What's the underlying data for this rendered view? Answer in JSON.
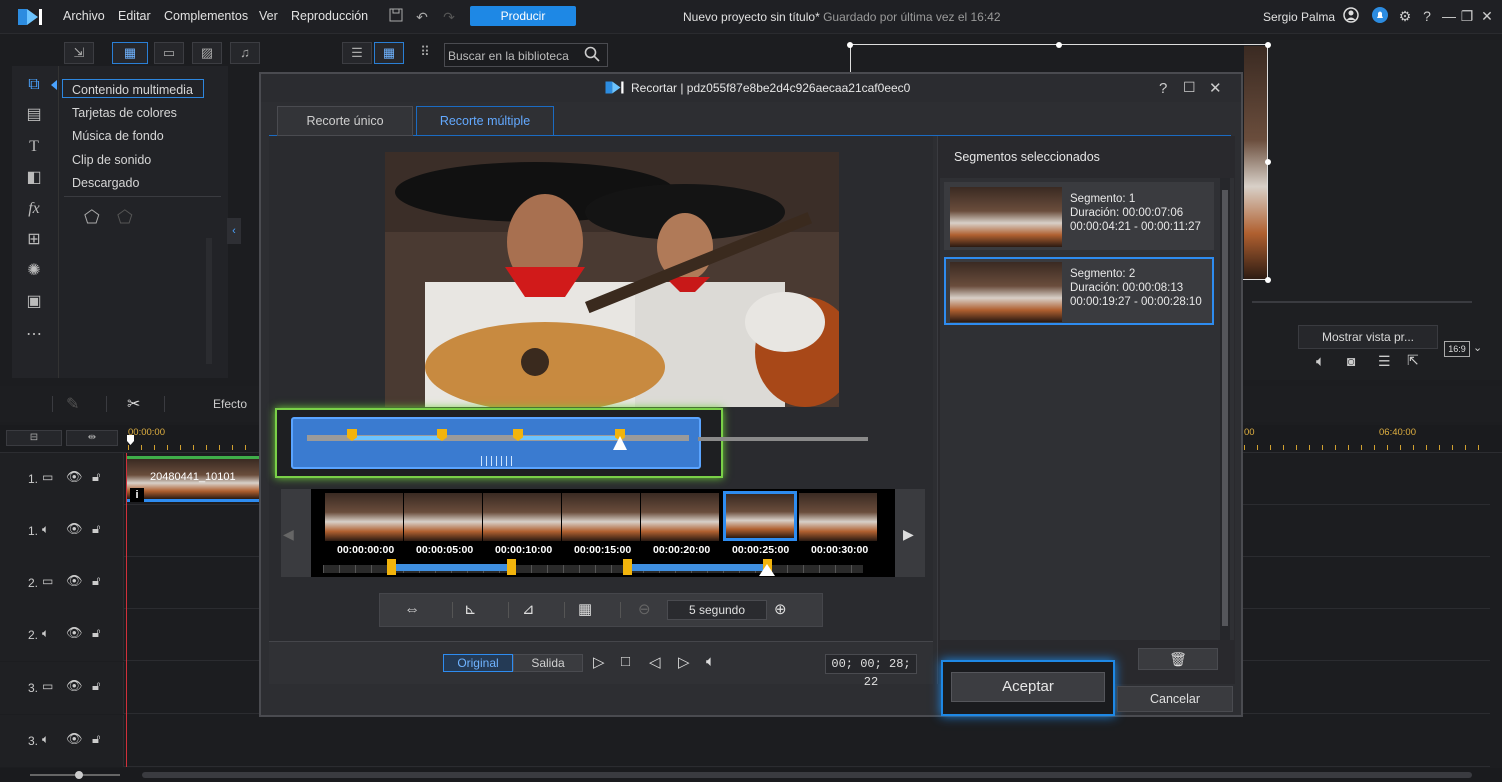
{
  "menubar": {
    "items": [
      "Archivo",
      "Editar",
      "Complementos",
      "Ver",
      "Reproducción"
    ],
    "produce_label": "Producir",
    "project_title": "Nuevo proyecto sin título*",
    "saved_status": "Guardado por última vez el 16:42",
    "user_name": "Sergio Palma"
  },
  "library": {
    "search_placeholder": "Buscar en la biblioteca",
    "items": [
      "Contenido multimedia",
      "Tarjetas de colores",
      "Música de fondo",
      "Clip de sonido",
      "Descargado"
    ]
  },
  "preview": {
    "full_preview_label": "Mostrar vista pr...",
    "aspect_ratio": "16:9"
  },
  "timeline": {
    "effect_label": "Efecto",
    "ruler_start": "00:00:00",
    "ruler_mark_1": "00",
    "ruler_mark_2": "06:40:00",
    "clip_label": "20480441_10101",
    "tracks": [
      "1.",
      "1.",
      "2.",
      "2.",
      "3.",
      "3."
    ]
  },
  "dialog": {
    "title": "Recortar | pdz055f87e8be2d4c926aecaa21caf0eec0",
    "tabs": [
      "Recorte único",
      "Recorte múltiple"
    ],
    "selected_tab": 1,
    "filmstrip_timecodes": [
      "00:00:00:00",
      "00:00:05:00",
      "00:00:10:00",
      "00:00:15:00",
      "00:00:20:00",
      "00:00:25:00",
      "00:00:30:00"
    ],
    "zoom_label": "5 segundo",
    "original_label": "Original",
    "output_label": "Salida",
    "current_time": "00; 00; 28; 22",
    "segments_header": "Segmentos seleccionados",
    "segments": [
      {
        "name": "Segmento: 1",
        "duration": "Duración: 00:00:07:06",
        "range": "00:00:04:21 - 00:00:11:27"
      },
      {
        "name": "Segmento: 2",
        "duration": "Duración: 00:00:08:13",
        "range": "00:00:19:27 - 00:00:28:10"
      }
    ],
    "accept_label": "Aceptar",
    "cancel_label": "Cancelar"
  },
  "colors": {
    "accent": "#1e88e5",
    "highlight_green": "#6fcf3a",
    "highlight_blue": "#2e8cf0",
    "marker_yellow": "#f2b40c"
  }
}
